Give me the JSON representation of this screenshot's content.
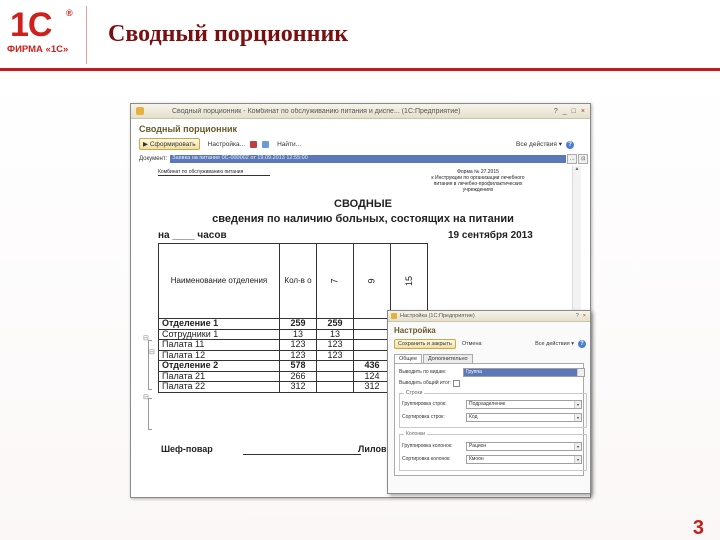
{
  "slide": {
    "logo_text": "1С",
    "logo_reg": "®",
    "logo_caption": "ФИРМА «1С»",
    "title": "Сводный порционник",
    "page_number": "3",
    "accent_color": "#c8181b"
  },
  "window": {
    "title": "Сводный порционник - Комбинат по обслуживанию питания и диспе... (1С:Предприятие)",
    "controls": [
      "?",
      "_",
      "□",
      "×"
    ],
    "form_title": "Сводный порционник",
    "toolbar": {
      "generate": "Сформировать",
      "settings": "Настройка...",
      "find": "Найти...",
      "all_actions": "Все действия",
      "help": "?"
    },
    "document_label": "Документ:",
    "document_value": "Заявка на питание 0С-000002 от 19.09.2013 12:55:00"
  },
  "report": {
    "organization": "Комбинат по обслуживанию питания",
    "form_ref_lines": [
      "Форма № 27.2015",
      "к Инструкции по организации лечебного",
      "питания в лечебно-профилактических",
      "учреждениях"
    ],
    "title_line1": "СВОДНЫЕ",
    "title_line2": "сведения по наличию больных, состоящих на питании",
    "at_label": "на ____ часов",
    "date": "19 сентября 2013",
    "header": {
      "name": "Наименование отделения",
      "count": "Кол-в о",
      "c1": "7",
      "c2": "9",
      "c3": "15"
    },
    "rows": [
      {
        "name": "Отделение 1",
        "count": "259",
        "c1": "259",
        "c2": "",
        "c3": "",
        "bold": true
      },
      {
        "name": "Сотрудники 1",
        "count": "13",
        "c1": "13",
        "c2": "",
        "c3": "",
        "bold": false
      },
      {
        "name": "Палата 11",
        "count": "123",
        "c1": "123",
        "c2": "",
        "c3": "",
        "bold": false
      },
      {
        "name": "Палата 12",
        "count": "123",
        "c1": "123",
        "c2": "",
        "c3": "",
        "bold": false
      },
      {
        "name": "Отделение 2",
        "count": "578",
        "c1": "",
        "c2": "436",
        "c3": "",
        "bold": true
      },
      {
        "name": "Палата 21",
        "count": "266",
        "c1": "",
        "c2": "124",
        "c3": "",
        "bold": false
      },
      {
        "name": "Палата 22",
        "count": "312",
        "c1": "",
        "c2": "312",
        "c3": "",
        "bold": false
      }
    ],
    "chef_label": "Шеф-повар",
    "chef_name": "Лилов"
  },
  "dialog": {
    "title": "Настройка (1С:Предприятие)",
    "heading": "Настройка",
    "save_close": "Сохранить и закрыть",
    "cancel": "Отмена",
    "all_actions": "Все действия",
    "help": "?",
    "tabs": [
      "Общее",
      "Дополнительно"
    ],
    "output_label": "Выводить по видам:",
    "output_value": "Группа",
    "total_label": "Выводить общий итог:",
    "rows_group_title": "Строки",
    "row_grouping_label": "Группировка строк:",
    "row_grouping_value": "Подразделение",
    "row_sort_label": "Сортировка строк:",
    "row_sort_value": "Код",
    "cols_group_title": "Колонки",
    "col_grouping_label": "Группировка колонок:",
    "col_grouping_value": "Рацион",
    "col_sort_label": "Сортировка колонок:",
    "col_sort_value": "Кмоон"
  }
}
